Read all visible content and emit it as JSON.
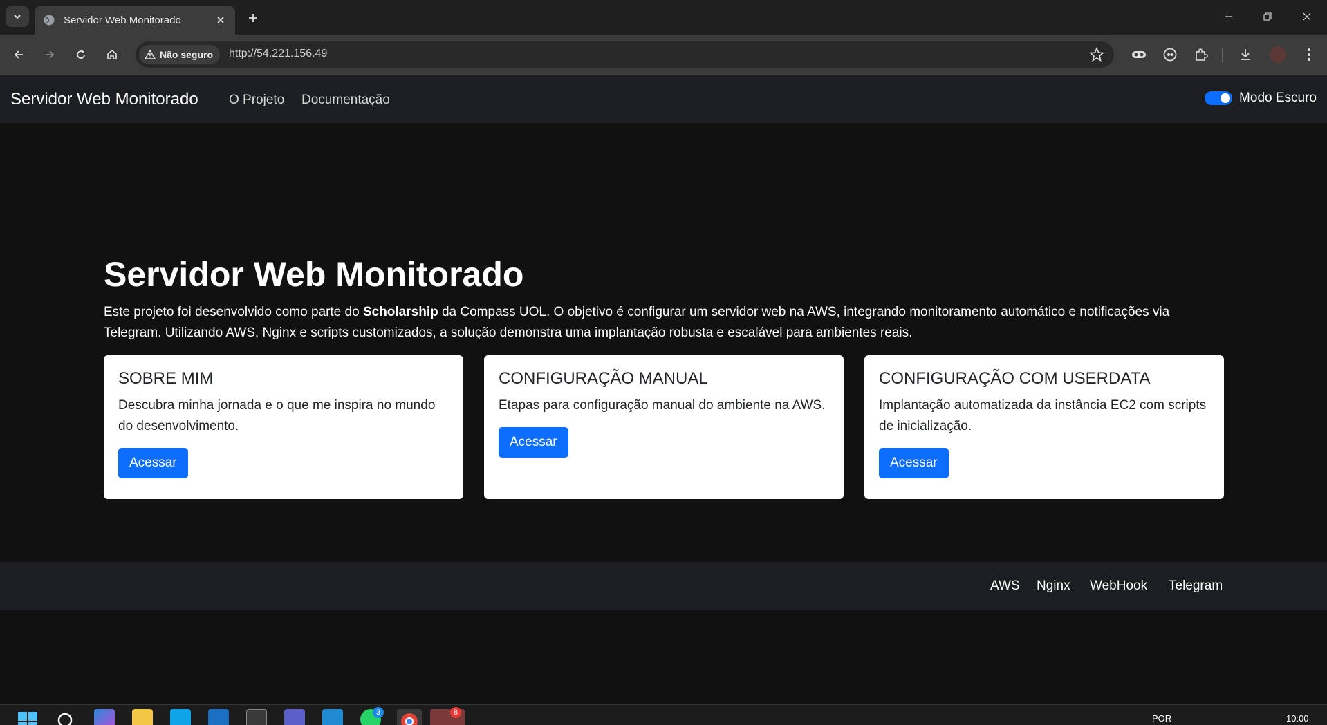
{
  "browser": {
    "tab_title": "Servidor Web Monitorado",
    "security_chip": "Não seguro",
    "url": "http://54.221.156.49"
  },
  "site": {
    "brand": "Servidor Web Monitorado",
    "nav": [
      {
        "label": "O Projeto"
      },
      {
        "label": "Documentação"
      }
    ],
    "dark_mode_label": "Modo Escuro",
    "dark_mode_enabled": true,
    "hero": {
      "title": "Servidor Web Monitorado",
      "text_before": "Este projeto foi desenvolvido como parte do ",
      "text_bold": "Scholarship",
      "text_after": " da Compass UOL. O objetivo é configurar um servidor web na AWS, integrando monitoramento automático e notificações via Telegram. Utilizando AWS, Nginx e scripts customizados, a solução demonstra uma implantação robusta e escalável para ambientes reais."
    },
    "cards": [
      {
        "title": "SOBRE MIM",
        "text": "Descubra minha jornada e o que me inspira no mundo do desenvolvimento.",
        "button": "Acessar"
      },
      {
        "title": "CONFIGURAÇÃO MANUAL",
        "text": "Etapas para configuração manual do ambiente na AWS.",
        "button": "Acessar"
      },
      {
        "title": "CONFIGURAÇÃO COM USERDATA",
        "text": "Implantação automatizada da instância EC2 com scripts de inicialização.",
        "button": "Acessar"
      }
    ],
    "footer_links": [
      {
        "label": "AWS"
      },
      {
        "label": "Nginx"
      },
      {
        "label": "WebHook"
      },
      {
        "label": "Telegram"
      }
    ]
  },
  "taskbar": {
    "language": "POR",
    "time": "10:00",
    "badges": {
      "whatsapp": "3",
      "telegram": "8"
    }
  },
  "colors": {
    "accent": "#0d6efd",
    "page_bg": "#111111",
    "nav_bg": "#1c1e21"
  }
}
